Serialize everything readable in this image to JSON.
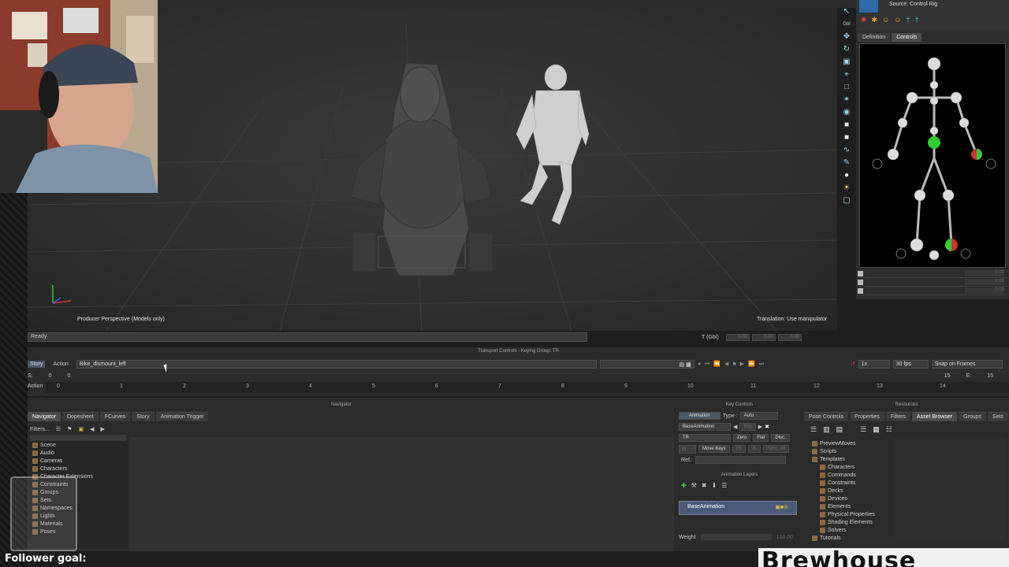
{
  "viewport": {
    "camera_label": "Producer Perspective (Models only)",
    "hint": "Translation: Use manipulator",
    "status": "Ready",
    "t_label": "T (Gbl)",
    "t_values": [
      "0.00",
      "0.00",
      "0.00"
    ]
  },
  "toolbar_right": {
    "source_label": "Source:",
    "source_value": "Control Rig",
    "gbl_label": "Gbl"
  },
  "controls_panel": {
    "tabs": [
      "Definition",
      "Controls"
    ],
    "active_tab": "Controls",
    "values": [
      "0.00",
      "0.00",
      "0.00"
    ]
  },
  "transport": {
    "title": "Transport Controls - Keying Group: TR",
    "mode_buttons": [
      "Story",
      "Action"
    ],
    "take_name": "Bike_dismount_left",
    "speed": "1x",
    "fps": "30 fps",
    "snap": "Snap on Frames",
    "s_label": "S:",
    "s_values": [
      "0",
      "0"
    ],
    "e_label": "E:",
    "e_values": [
      "15",
      "15"
    ],
    "track_label": "Action",
    "ruler": [
      "0",
      "1",
      "2",
      "3",
      "4",
      "5",
      "6",
      "7",
      "8",
      "9",
      "10",
      "11",
      "12",
      "13",
      "14"
    ]
  },
  "navigator": {
    "title": "Navigator",
    "tabs": [
      "Navigator",
      "Dopesheet",
      "FCurves",
      "Story",
      "Animation Trigger"
    ],
    "filter_label": "Filters...",
    "tree": [
      "Scene",
      "Audio",
      "Cameras",
      "Characters",
      "Character Extensions",
      "Constraints",
      "Groups",
      "Sets",
      "Namespaces",
      "Lights",
      "Materials",
      "Poses"
    ]
  },
  "key_controls": {
    "title": "Key Controls",
    "animation_label": "Animation",
    "type_label": "Type :",
    "type_value": "Auto",
    "layer_value": "BaseAnimation",
    "tr_value": "TR",
    "zero": "Zero",
    "flat": "Flat",
    "disc": "Disc.",
    "move_keys": "Move Keys",
    "fk": "FK",
    "ik": "IK",
    "sync_all": "Sync. All",
    "ref_label": "Ref.:",
    "key_label": "Key"
  },
  "animation_layers": {
    "title": "Animation Layers",
    "layer": "BaseAnimation",
    "weight_label": "Weight",
    "weight_value": "100.00"
  },
  "resources": {
    "title": "Resources",
    "tabs": [
      "Pose Controls",
      "Properties",
      "Filters",
      "Asset Browser",
      "Groups",
      "Sets"
    ],
    "active_tab": "Asset Browser",
    "tree": [
      "PreviewMoves",
      "Scripts",
      "Templates",
      "Characters",
      "Commands",
      "Constraints",
      "Decks",
      "Devices",
      "Elements",
      "Physical Properties",
      "Shading Elements",
      "Solvers",
      "Tutorials"
    ]
  },
  "overlay": {
    "follower_goal": "Follower goal:",
    "brand": "Brewhouse"
  },
  "colors": {
    "accent_blue": "#4a5a78",
    "effector_green": "#33cc33",
    "effector_red": "#cc3333"
  }
}
